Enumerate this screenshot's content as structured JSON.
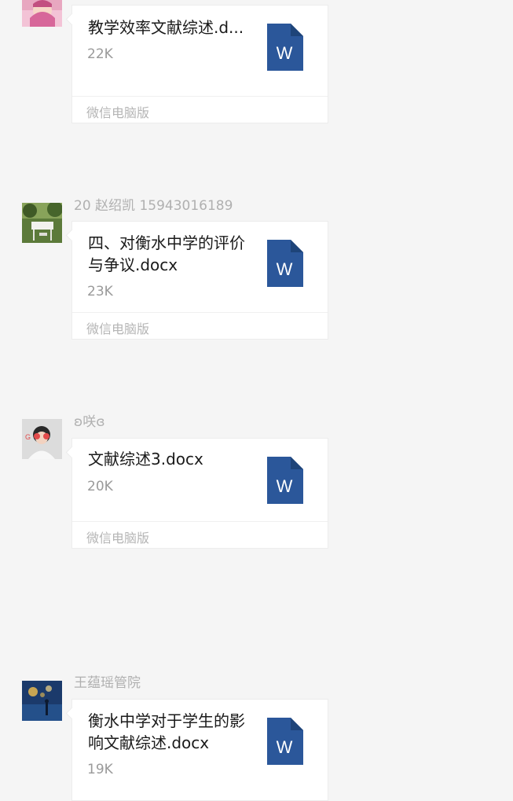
{
  "messages": [
    {
      "sender": "",
      "file_name": "教学效率文献综述.d...",
      "file_size": "22K",
      "footer": "微信电脑版",
      "icon_letter": "W"
    },
    {
      "sender": "20  赵绍凯  15943016189",
      "file_name": "四、对衡水中学的评价与争议.docx",
      "file_size": "23K",
      "footer": "微信电脑版",
      "icon_letter": "W"
    },
    {
      "sender": "ʚ咲ɞ",
      "file_name": "文献综述3.docx",
      "file_size": "20K",
      "footer": "微信电脑版",
      "icon_letter": "W"
    },
    {
      "sender": "王蕴瑶管院",
      "file_name": "衡水中学对于学生的影响文献综述.docx",
      "file_size": "19K",
      "footer": "",
      "icon_letter": "W"
    }
  ],
  "colors": {
    "background": "#f5f5f5",
    "word_icon": "#2b579a",
    "word_icon_fold": "#1e4479",
    "secondary_text": "#b0b0b0"
  }
}
